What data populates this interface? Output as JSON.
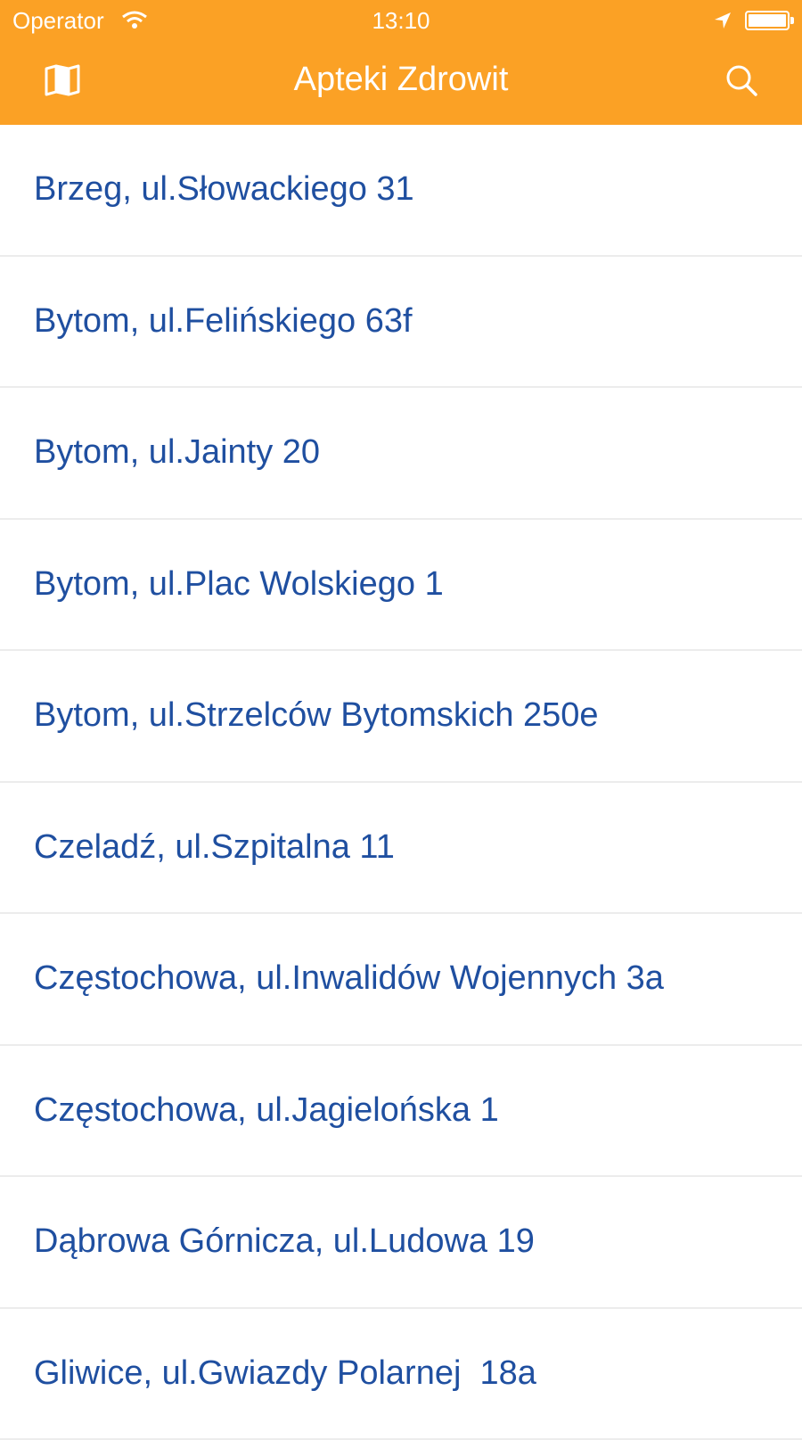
{
  "status_bar": {
    "carrier": "Operator",
    "time": "13:10"
  },
  "nav": {
    "title": "Apteki Zdrowit",
    "left_icon": "map-icon",
    "right_icon": "search-icon"
  },
  "colors": {
    "header": "#FBA125",
    "item_text": "#1F4FA0",
    "separator": "#ECECEC"
  },
  "pharmacies": [
    {
      "label": "Brzeg, ul.Słowackiego 31"
    },
    {
      "label": "Bytom, ul.Felińskiego 63f"
    },
    {
      "label": "Bytom, ul.Jainty 20"
    },
    {
      "label": "Bytom, ul.Plac Wolskiego 1"
    },
    {
      "label": "Bytom, ul.Strzelców Bytomskich 250e"
    },
    {
      "label": "Czeladź, ul.Szpitalna 11"
    },
    {
      "label": "Częstochowa, ul.Inwalidów Wojennych 3a"
    },
    {
      "label": "Częstochowa, ul.Jagielońska 1"
    },
    {
      "label": "Dąbrowa Górnicza, ul.Ludowa 19"
    },
    {
      "label": "Gliwice, ul.Gwiazdy Polarnej  18a"
    }
  ]
}
